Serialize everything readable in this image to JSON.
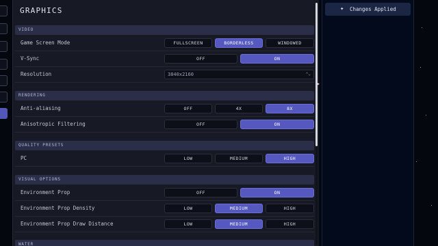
{
  "panel_title": "GRAPHICS",
  "toast": {
    "icon": "sparkles-icon",
    "label": "Changes Applied"
  },
  "sections": {
    "video": "VIDEO",
    "rendering": "RENDERING",
    "quality_presets": "QUALITY PRESETS",
    "visual_options": "VISUAL OPTIONS",
    "water": "WATER"
  },
  "rows": {
    "game_screen_mode": {
      "label": "Game Screen Mode",
      "options": [
        "FULLSCREEN",
        "BORDERLESS",
        "WINDOWED"
      ],
      "selected": "BORDERLESS"
    },
    "vsync": {
      "label": "V-Sync",
      "options": [
        "OFF",
        "ON"
      ],
      "selected": "ON"
    },
    "resolution": {
      "label": "Resolution",
      "value": "3840x2160"
    },
    "anti_aliasing": {
      "label": "Anti-aliasing",
      "options": [
        "OFF",
        "4X",
        "8X"
      ],
      "selected": "8X"
    },
    "anisotropic": {
      "label": "Anisotropic Filtering",
      "options": [
        "OFF",
        "ON"
      ],
      "selected": "ON"
    },
    "pc": {
      "label": "PC",
      "options": [
        "LOW",
        "MEDIUM",
        "HIGH"
      ],
      "selected": "HIGH"
    },
    "env_prop": {
      "label": "Environment Prop",
      "options": [
        "OFF",
        "ON"
      ],
      "selected": "ON"
    },
    "env_prop_density": {
      "label": "Environment Prop Density",
      "options": [
        "LOW",
        "MEDIUM",
        "HIGH"
      ],
      "selected": "MEDIUM"
    },
    "env_prop_draw_distance": {
      "label": "Environment Prop Draw Distance",
      "options": [
        "LOW",
        "MEDIUM",
        "HIGH"
      ],
      "selected": "MEDIUM"
    }
  },
  "colors": {
    "accent": "#5458bf",
    "panel_bg": "#171a24",
    "section_bg": "#2a2e48",
    "right_panel_bg": "#020a1c"
  }
}
